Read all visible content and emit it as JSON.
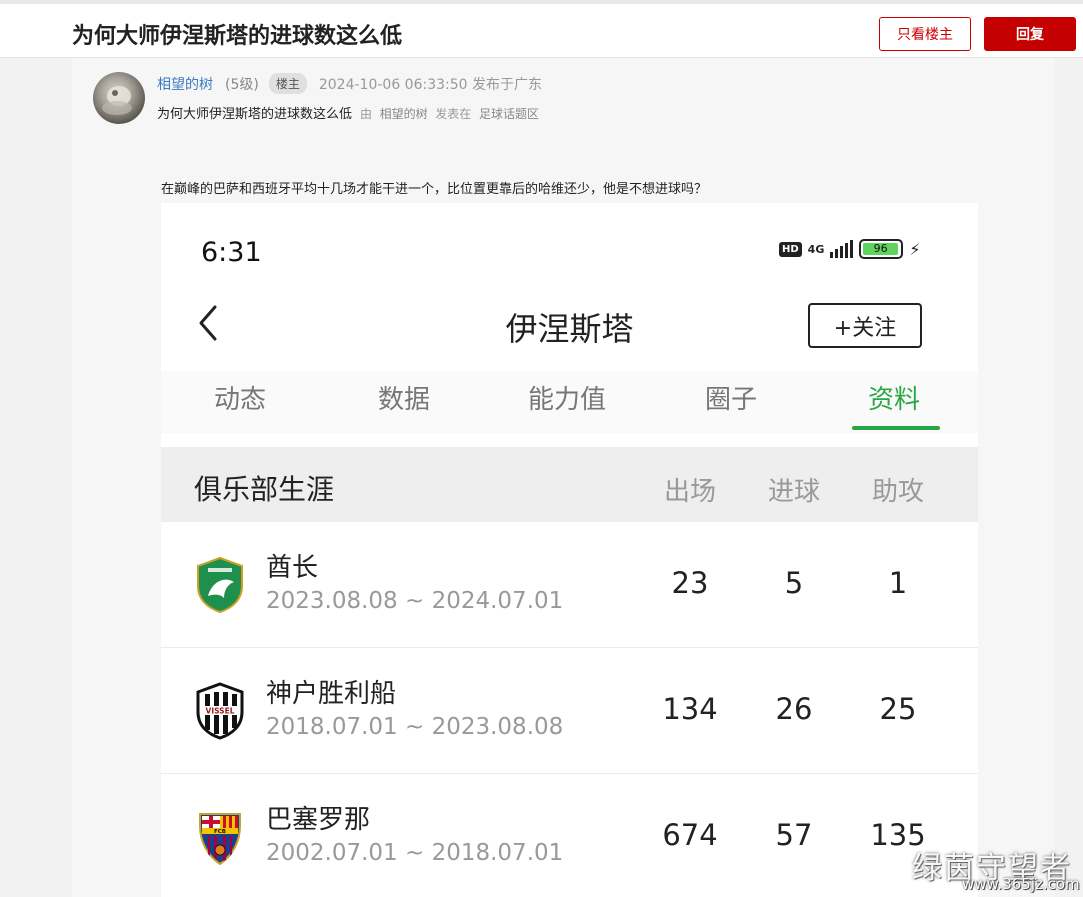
{
  "header": {
    "title": "为何大师伊涅斯塔的进球数这么低",
    "only_op_label": "只看楼主",
    "reply_label": "回复"
  },
  "post": {
    "author": "相望的树",
    "level": "(5级)",
    "badge": "楼主",
    "time": "2024-10-06 06:33:50 发布于广东",
    "subtitle": "为何大师伊涅斯塔的进球数这么低",
    "by": "由",
    "by_author": "相望的树",
    "posted_in": "发表在",
    "forum": "足球话题区",
    "body": "在巅峰的巴萨和西班牙平均十几场才能干进一个，比位置更靠后的哈维还少，他是不想进球吗？"
  },
  "phone": {
    "clock": "6:31",
    "hd": "HD",
    "network": "4G",
    "battery_level": "96",
    "battery_fraction": 0.96,
    "page_title": "伊涅斯塔",
    "follow_label": "+关注",
    "tabs": [
      {
        "label": "动态"
      },
      {
        "label": "数据"
      },
      {
        "label": "能力值"
      },
      {
        "label": "圈子"
      },
      {
        "label": "资料",
        "active": true
      }
    ],
    "career": {
      "title": "俱乐部生涯",
      "columns": [
        "出场",
        "进球",
        "助攻"
      ],
      "rows": [
        {
          "club": "酋长",
          "dates": "2023.08.08 ~ 2024.07.01",
          "apps": "23",
          "goals": "5",
          "assists": "1",
          "crest": "emirates-crest-icon"
        },
        {
          "club": "神户胜利船",
          "dates": "2018.07.01 ~ 2023.08.08",
          "apps": "134",
          "goals": "26",
          "assists": "25",
          "crest": "vissel-kobe-crest-icon",
          "crest_text": "VISSEL"
        },
        {
          "club": "巴塞罗那",
          "dates": "2002.07.01 ~ 2018.07.01",
          "apps": "674",
          "goals": "57",
          "assists": "135",
          "crest": "barcelona-crest-icon",
          "crest_text": "FCB"
        }
      ]
    }
  },
  "watermark": {
    "text": "绿茵守望者",
    "url": "www.365jz.com"
  },
  "colors": {
    "accent_red": "#c40000",
    "link_blue": "#3b7bc2",
    "tab_active_green": "#28a745"
  }
}
